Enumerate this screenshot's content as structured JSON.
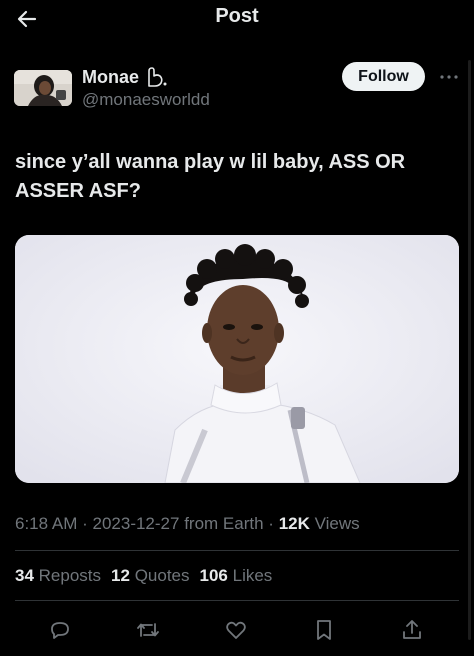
{
  "header": {
    "title": "Post"
  },
  "author": {
    "display_name": "Monae",
    "handle": "@monaesworldd",
    "follow_label": "Follow"
  },
  "tweet": {
    "text": "since y’all wanna play w lil baby, ASS OR ASSER ASF?"
  },
  "meta": {
    "time": "6:18 AM",
    "date": "2023-12-27",
    "source": "from Earth",
    "views_count": "12K",
    "views_label": "Views"
  },
  "stats": {
    "reposts_count": "34",
    "reposts_label": "Reposts",
    "quotes_count": "12",
    "quotes_label": "Quotes",
    "likes_count": "106",
    "likes_label": "Likes"
  },
  "icons": {
    "back": "back-arrow-icon",
    "more": "more-dots-icon",
    "reply": "reply-icon",
    "repost": "repost-icon",
    "like": "heart-icon",
    "bookmark": "bookmark-icon",
    "share": "share-icon"
  },
  "colors": {
    "background": "#000000",
    "text_primary": "#e7e9ea",
    "text_secondary": "#71767b",
    "divider": "#2f3336",
    "follow_button_bg": "#eff3f4"
  }
}
